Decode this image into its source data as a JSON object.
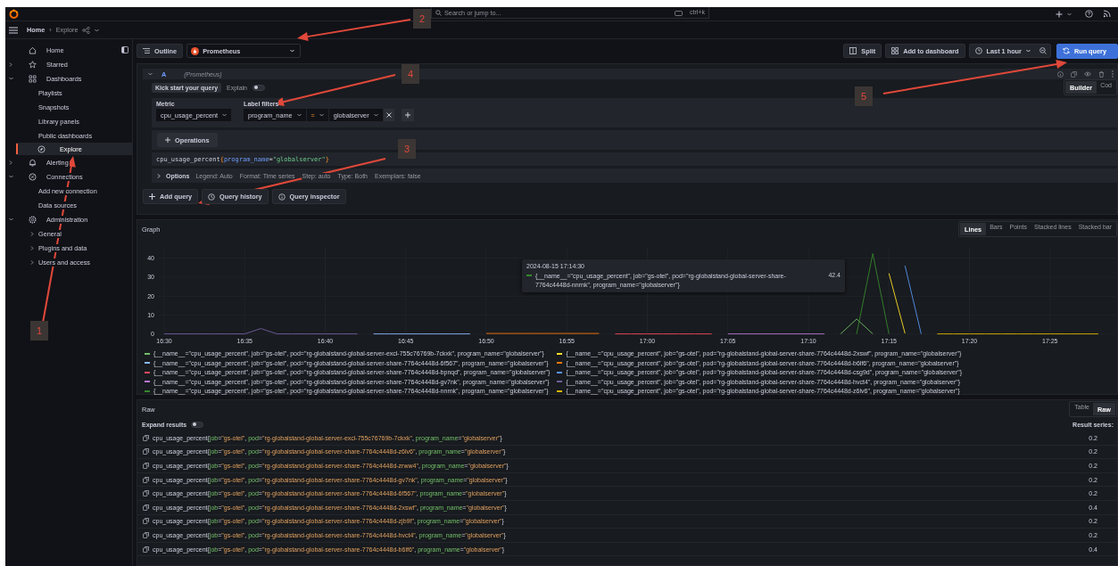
{
  "top_bar": {
    "search": {
      "placeholder": "Search or jump to...",
      "shortcut": "ctrl+k"
    }
  },
  "breadcrumbs": {
    "items": [
      "Home",
      "Explore"
    ],
    "separator": "›"
  },
  "sidebar": {
    "items": [
      {
        "label": "Home",
        "selected": false
      },
      {
        "label": "Starred",
        "selected": false,
        "expanded": false
      },
      {
        "label": "Dashboards",
        "selected": false,
        "expanded": true,
        "children": [
          {
            "label": "Playlists"
          },
          {
            "label": "Snapshots"
          },
          {
            "label": "Library panels"
          },
          {
            "label": "Public dashboards"
          }
        ]
      },
      {
        "label": "Explore",
        "selected": true
      },
      {
        "label": "Alerting",
        "selected": false,
        "expanded": false
      },
      {
        "label": "Connections",
        "selected": false,
        "expanded": true,
        "children": [
          {
            "label": "Add new connection"
          },
          {
            "label": "Data sources"
          }
        ]
      },
      {
        "label": "Administration",
        "selected": false,
        "expanded": true,
        "children": [
          {
            "label": "General",
            "expanded": false
          },
          {
            "label": "Plugins and data",
            "expanded": false
          },
          {
            "label": "Users and access",
            "expanded": false
          }
        ]
      }
    ]
  },
  "toolbar": {
    "outline": "Outline",
    "datasource": "Prometheus",
    "split": "Split",
    "add_to_dashboard": "Add to dashboard",
    "time_range": "Last 1 hour",
    "run_query": "Run query"
  },
  "query": {
    "ref": "A",
    "datasource": "(Prometheus)",
    "modes": [
      {
        "label": "Builder",
        "selected": true
      },
      {
        "label": "Cod",
        "selected": false
      }
    ],
    "kick_start": "Kick start your query",
    "explain": {
      "label": "Explain",
      "on": false
    },
    "metric_label": "Metric",
    "metric": "cpu_usage_percent",
    "label_filters_label": "Label filters",
    "filter": {
      "label": "program_name",
      "operator": "=",
      "value": "globalserver"
    },
    "operations": "Operations",
    "preview": [
      {
        "text": "cpu_usage_percent",
        "kind": "metric"
      },
      {
        "text": "{",
        "kind": "brace"
      },
      {
        "text": "program_name",
        "kind": "label"
      },
      {
        "text": "=",
        "kind": "metric"
      },
      {
        "text": "\"globalserver\"",
        "kind": "string"
      },
      {
        "text": "}",
        "kind": "brace"
      }
    ],
    "options": {
      "title": "Options",
      "items": [
        "Legend: Auto",
        "Format: Time series",
        "Step: auto",
        "Type: Both",
        "Exemplars: false"
      ]
    }
  },
  "query_buttons": [
    "Add query",
    "Query history",
    "Query inspector"
  ],
  "graph": {
    "title": "Graph",
    "views": [
      {
        "label": "Lines",
        "selected": true
      },
      {
        "label": "Bars",
        "selected": false
      },
      {
        "label": "Points",
        "selected": false
      },
      {
        "label": "Stacked lines",
        "selected": false
      },
      {
        "label": "Stacked bar",
        "selected": false
      }
    ],
    "chart_data": {
      "type": "line",
      "categories": [
        "16:30",
        null,
        null,
        null,
        null,
        "16:35",
        null,
        null,
        null,
        null,
        "16:40",
        null,
        null,
        null,
        null,
        "16:45",
        null,
        null,
        null,
        null,
        "16:50",
        null,
        null,
        null,
        null,
        "16:55",
        null,
        null,
        null,
        null,
        "17:00",
        null,
        null,
        null,
        null,
        "17:05",
        null,
        null,
        null,
        null,
        "17:10",
        null,
        null,
        null,
        null,
        "17:15",
        null,
        null,
        null,
        null,
        "17:20",
        null,
        null,
        null,
        null,
        "17:25",
        null,
        null,
        null
      ],
      "ylim": [
        0,
        45
      ],
      "yticks": [
        0,
        10,
        20,
        30,
        40
      ],
      "grid": true,
      "series": [
        {
          "name": "{__name__=\"cpu_usage_percent\", job=\"gs-otel\", pod=\"rg-globalstand-global-server-excl-755c76769b-7ckxk\", program_name=\"globalserver\"}",
          "color": "#73bf69",
          "values": [
            null,
            null,
            null,
            null,
            null,
            null,
            null,
            null,
            null,
            null,
            null,
            null,
            null,
            null,
            null,
            null,
            null,
            null,
            null,
            null,
            null,
            null,
            null,
            null,
            null,
            null,
            null,
            null,
            null,
            null,
            null,
            null,
            null,
            null,
            null,
            null,
            null,
            null,
            null,
            null,
            null,
            null,
            0.2,
            8,
            0.2,
            null,
            null,
            null,
            null,
            null,
            null,
            null,
            null,
            null,
            null,
            null,
            null,
            null,
            null
          ]
        },
        {
          "name": "{__name__=\"cpu_usage_percent\", job=\"gs-otel\", pod=\"rg-globalstand-global-server-share-7764c4448d-2xswf\", program_name=\"globalserver\"}",
          "color": "#fade2a",
          "values": [
            null,
            null,
            null,
            null,
            null,
            null,
            null,
            null,
            null,
            null,
            null,
            null,
            null,
            null,
            null,
            null,
            null,
            null,
            null,
            null,
            null,
            null,
            null,
            null,
            null,
            null,
            null,
            null,
            null,
            null,
            null,
            null,
            null,
            null,
            null,
            null,
            null,
            null,
            null,
            null,
            null,
            null,
            null,
            null,
            null,
            32,
            0.4,
            null,
            null,
            null,
            null,
            null,
            null,
            null,
            null,
            null,
            null,
            null,
            null
          ]
        },
        {
          "name": "{__name__=\"cpu_usage_percent\", job=\"gs-otel\", pod=\"rg-globalstand-global-server-share-7764c4448d-6f567\", program_name=\"globalserver\"}",
          "color": "#8ab8ff",
          "values": [
            null,
            null,
            null,
            null,
            null,
            null,
            null,
            null,
            null,
            null,
            null,
            null,
            null,
            0.2,
            0.2,
            0.2,
            0.2,
            0.2,
            0.2,
            0.2,
            null,
            null,
            null,
            null,
            null,
            null,
            null,
            null,
            null,
            null,
            null,
            null,
            null,
            null,
            null,
            null,
            null,
            null,
            null,
            null,
            null,
            null,
            null,
            null,
            null,
            null,
            null,
            null,
            null,
            null,
            null,
            null,
            null,
            null,
            null,
            null,
            null,
            null,
            null
          ]
        },
        {
          "name": "{__name__=\"cpu_usage_percent\", job=\"gs-otel\", pod=\"rg-globalstand-global-server-share-7764c4448d-b6lf6\", program_name=\"globalserver\"}",
          "color": "#ff780a",
          "values": [
            null,
            null,
            null,
            null,
            null,
            null,
            null,
            null,
            null,
            null,
            null,
            null,
            null,
            null,
            null,
            null,
            null,
            null,
            null,
            null,
            0.4,
            0.4,
            0.4,
            0.4,
            0.4,
            0.4,
            0.4,
            0.4,
            null,
            null,
            null,
            null,
            null,
            null,
            null,
            null,
            null,
            null,
            null,
            null,
            null,
            null,
            null,
            null,
            null,
            null,
            null,
            null,
            null,
            null,
            null,
            null,
            null,
            null,
            null,
            null,
            null,
            null,
            null
          ]
        },
        {
          "name": "{__name__=\"cpu_usage_percent\", job=\"gs-otel\", pod=\"rg-globalstand-global-server-share-7764c4448d-bpnqd\", program_name=\"globalserver\"}",
          "color": "#f2495c",
          "values": [
            null,
            null,
            null,
            null,
            null,
            null,
            null,
            null,
            null,
            null,
            null,
            null,
            null,
            null,
            null,
            null,
            null,
            null,
            null,
            null,
            null,
            null,
            null,
            null,
            null,
            null,
            null,
            null,
            0.2,
            0.2,
            0.2,
            0.2,
            0.2,
            0.2,
            0.2,
            null,
            null,
            null,
            null,
            null,
            null,
            null,
            null,
            null,
            null,
            null,
            null,
            null,
            null,
            null,
            null,
            null,
            null,
            null,
            null,
            null,
            null,
            null,
            null
          ]
        },
        {
          "name": "{__name__=\"cpu_usage_percent\", job=\"gs-otel\", pod=\"rg-globalstand-global-server-share-7764c4448d-csg9d\", program_name=\"globalserver\"}",
          "color": "#5794f2",
          "values": [
            null,
            null,
            null,
            null,
            null,
            null,
            null,
            null,
            null,
            null,
            null,
            null,
            null,
            null,
            null,
            null,
            null,
            null,
            null,
            null,
            null,
            null,
            null,
            null,
            null,
            null,
            null,
            null,
            null,
            null,
            null,
            null,
            null,
            null,
            null,
            null,
            null,
            null,
            null,
            null,
            null,
            null,
            null,
            null,
            null,
            null,
            36,
            0.2,
            null,
            null,
            null,
            null,
            null,
            null,
            null,
            null,
            null,
            null,
            null
          ]
        },
        {
          "name": "{__name__=\"cpu_usage_percent\", job=\"gs-otel\", pod=\"rg-globalstand-global-server-share-7764c4448d-gv7nk\", program_name=\"globalserver\"}",
          "color": "#b877d9",
          "values": [
            null,
            null,
            null,
            null,
            null,
            null,
            null,
            null,
            null,
            null,
            null,
            null,
            null,
            null,
            null,
            null,
            null,
            null,
            null,
            null,
            null,
            null,
            null,
            null,
            null,
            null,
            null,
            null,
            null,
            null,
            null,
            null,
            null,
            null,
            null,
            0.2,
            0.2,
            0.2,
            0.2,
            0.2,
            0.2,
            0.2,
            null,
            null,
            null,
            null,
            null,
            null,
            null,
            null,
            null,
            null,
            null,
            null,
            null,
            null,
            null,
            null,
            null
          ]
        },
        {
          "name": "{__name__=\"cpu_usage_percent\", job=\"gs-otel\", pod=\"rg-globalstand-global-server-share-7764c4448d-hvct4\", program_name=\"globalserver\"}",
          "color": "#705da0",
          "values": [
            0.2,
            0.2,
            0.2,
            0.2,
            0.2,
            0.2,
            3,
            0.2,
            0.2,
            0.2,
            0.2,
            0.2,
            0.2,
            null,
            null,
            null,
            null,
            null,
            null,
            null,
            null,
            null,
            null,
            null,
            null,
            null,
            null,
            null,
            null,
            null,
            null,
            null,
            null,
            null,
            null,
            null,
            null,
            null,
            null,
            null,
            null,
            null,
            null,
            null,
            null,
            null,
            null,
            null,
            null,
            null,
            null,
            null,
            null,
            null,
            null,
            null,
            null,
            null,
            null
          ]
        },
        {
          "name": "{__name__=\"cpu_usage_percent\", job=\"gs-otel\", pod=\"rg-globalstand-global-server-share-7764c4448d-nnrnk\", program_name=\"globalserver\"}",
          "color": "#37872d",
          "values": [
            null,
            null,
            null,
            null,
            null,
            null,
            null,
            null,
            null,
            null,
            null,
            null,
            null,
            null,
            null,
            null,
            null,
            null,
            null,
            null,
            null,
            null,
            null,
            null,
            null,
            null,
            null,
            null,
            null,
            null,
            null,
            null,
            null,
            null,
            null,
            null,
            null,
            null,
            null,
            null,
            null,
            null,
            null,
            0.2,
            42.4,
            0.2,
            null,
            null,
            null,
            null,
            null,
            null,
            null,
            null,
            null,
            null,
            null,
            null,
            null
          ]
        },
        {
          "name": "{__name__=\"cpu_usage_percent\", job=\"gs-otel\", pod=\"rg-globalstand-global-server-share-7764c4448d-z6lv6\", program_name=\"globalserver\"}",
          "color": "#e0b400",
          "values": [
            null,
            null,
            null,
            null,
            null,
            null,
            null,
            null,
            null,
            null,
            null,
            null,
            null,
            null,
            null,
            null,
            null,
            null,
            null,
            null,
            null,
            null,
            null,
            null,
            null,
            null,
            null,
            null,
            null,
            null,
            null,
            null,
            null,
            null,
            null,
            null,
            null,
            null,
            null,
            null,
            null,
            null,
            null,
            null,
            null,
            null,
            null,
            null,
            0.2,
            0.2,
            0.2,
            0.2,
            0.2,
            0.2,
            0.2,
            0.2,
            0.2,
            0.2,
            0.2
          ]
        }
      ]
    },
    "tooltip": {
      "time": "2024-08-15 17:14:30",
      "label": "{__name__=\"cpu_usage_percent\", job=\"gs-otel\", pod=\"rg-globalstand-global-server-share-7764c4448d-nnrnk\", program_name=\"globalserver\"}",
      "value": "42.4",
      "color": "#37872d"
    }
  },
  "raw": {
    "title": "Raw",
    "views": [
      {
        "label": "Table",
        "selected": false
      },
      {
        "label": "Raw",
        "selected": true
      }
    ],
    "expand": {
      "label": "Expand results",
      "on": false
    },
    "result_label": "Result series:",
    "rows": [
      {
        "parts": [
          "cpu_usage_percent{",
          "job",
          "=",
          "\"gs-otel\"",
          ", ",
          "pod",
          "=",
          "\"rg-globalstand-global-server-excl-755c76769b-7ckxk\"",
          ", ",
          "program_name",
          "=",
          "\"globalserver\"",
          "}"
        ],
        "value": "0.2"
      },
      {
        "parts": [
          "cpu_usage_percent{",
          "job",
          "=",
          "\"gs-otel\"",
          ", ",
          "pod",
          "=",
          "\"rg-globalstand-global-server-share-7764c4448d-z6lv6\"",
          ", ",
          "program_name",
          "=",
          "\"globalserver\"",
          "}"
        ],
        "value": "0.2"
      },
      {
        "parts": [
          "cpu_usage_percent{",
          "job",
          "=",
          "\"gs-otel\"",
          ", ",
          "pod",
          "=",
          "\"rg-globalstand-global-server-share-7764c4448d-zrww4\"",
          ", ",
          "program_name",
          "=",
          "\"globalserver\"",
          "}"
        ],
        "value": "0.2"
      },
      {
        "parts": [
          "cpu_usage_percent{",
          "job",
          "=",
          "\"gs-otel\"",
          ", ",
          "pod",
          "=",
          "\"rg-globalstand-global-server-share-7764c4448d-gv7nk\"",
          ", ",
          "program_name",
          "=",
          "\"globalserver\"",
          "}"
        ],
        "value": "0.2"
      },
      {
        "parts": [
          "cpu_usage_percent{",
          "job",
          "=",
          "\"gs-otel\"",
          ", ",
          "pod",
          "=",
          "\"rg-globalstand-global-server-share-7764c4448d-6f567\"",
          ", ",
          "program_name",
          "=",
          "\"globalserver\"",
          "}"
        ],
        "value": "0.2"
      },
      {
        "parts": [
          "cpu_usage_percent{",
          "job",
          "=",
          "\"gs-otel\"",
          ", ",
          "pod",
          "=",
          "\"rg-globalstand-global-server-share-7764c4448d-2xswf\"",
          ", ",
          "program_name",
          "=",
          "\"globalserver\"",
          "}"
        ],
        "value": "0.4"
      },
      {
        "parts": [
          "cpu_usage_percent{",
          "job",
          "=",
          "\"gs-otel\"",
          ", ",
          "pod",
          "=",
          "\"rg-globalstand-global-server-share-7764c4448d-zjb9f\"",
          ", ",
          "program_name",
          "=",
          "\"globalserver\"",
          "}"
        ],
        "value": "0.2"
      },
      {
        "parts": [
          "cpu_usage_percent{",
          "job",
          "=",
          "\"gs-otel\"",
          ", ",
          "pod",
          "=",
          "\"rg-globalstand-global-server-share-7764c4448d-hvct4\"",
          ", ",
          "program_name",
          "=",
          "\"globalserver\"",
          "}"
        ],
        "value": "0.2"
      },
      {
        "parts": [
          "cpu_usage_percent{",
          "job",
          "=",
          "\"gs-otel\"",
          ", ",
          "pod",
          "=",
          "\"rg-globalstand-global-server-share-7764c4448d-b6lf6\"",
          ", ",
          "program_name",
          "=",
          "\"globalserver\"",
          "}"
        ],
        "value": "0.4"
      }
    ]
  },
  "annotations": [
    {
      "label": "2"
    },
    {
      "label": "4"
    },
    {
      "label": "3"
    },
    {
      "label": "5"
    },
    {
      "label": "1"
    }
  ]
}
